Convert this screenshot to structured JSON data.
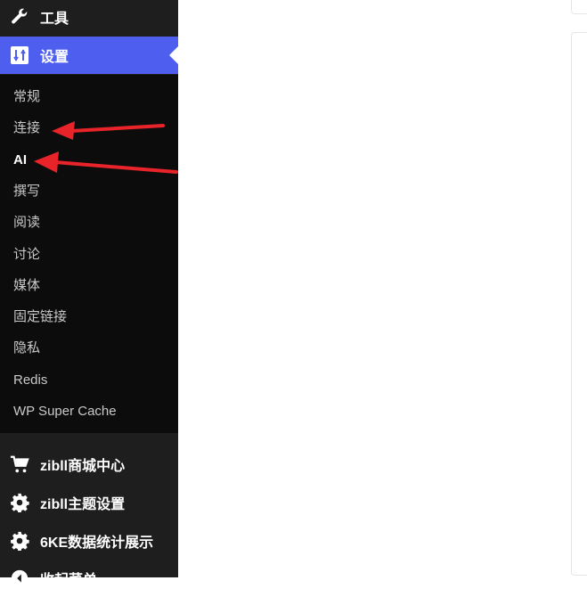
{
  "sidebar": {
    "tools_label": "工具",
    "settings_label": "设置",
    "submenu": [
      "常规",
      "连接",
      "AI",
      "撰写",
      "阅读",
      "讨论",
      "媒体",
      "固定链接",
      "隐私",
      "Redis",
      "WP Super Cache"
    ],
    "current_submenu": "AI",
    "extra_items": [
      {
        "label": "zibll商城中心",
        "icon": "cart-icon"
      },
      {
        "label": "zibll主题设置",
        "icon": "gear-icon"
      },
      {
        "label": "6KE数据统计展示",
        "icon": "gear-icon"
      },
      {
        "label": "收起菜单",
        "icon": "collapse-icon"
      }
    ]
  },
  "annotations": {
    "arrow_color": "#e8232a",
    "targets": [
      "连接",
      "AI"
    ]
  },
  "colors": {
    "sidebar_bg": "#1e1e1e",
    "submenu_bg": "#0c0c0c",
    "active_bg": "#4e5ff0"
  }
}
